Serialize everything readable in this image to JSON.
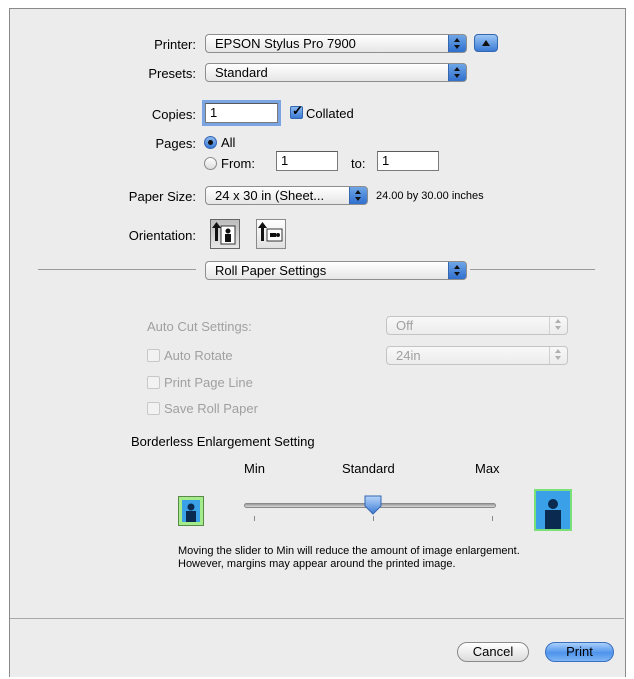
{
  "printer": {
    "label": "Printer:",
    "value": "EPSON Stylus Pro 7900"
  },
  "presets": {
    "label": "Presets:",
    "value": "Standard"
  },
  "copies": {
    "label": "Copies:",
    "value": "1",
    "collated_label": "Collated",
    "collated": true
  },
  "pages": {
    "label": "Pages:",
    "all_label": "All",
    "from_label": "From:",
    "from_value": "1",
    "to_label": "to:",
    "to_value": "1"
  },
  "paper_size": {
    "label": "Paper Size:",
    "value": "24 x 30 in (Sheet...",
    "dimensions": "24.00 by 30.00 inches"
  },
  "orientation": {
    "label": "Orientation:"
  },
  "panel_popup": {
    "value": "Roll Paper Settings"
  },
  "roll": {
    "auto_cut_label": "Auto Cut Settings:",
    "auto_cut_value": "Off",
    "auto_rotate_label": "Auto Rotate",
    "auto_rotate_value": "24in",
    "print_page_line_label": "Print Page Line",
    "save_roll_paper_label": "Save Roll Paper"
  },
  "borderless": {
    "title": "Borderless Enlargement Setting",
    "min_label": "Min",
    "standard_label": "Standard",
    "max_label": "Max",
    "slider_level": 0.5,
    "note_line1": "Moving the slider to Min will reduce the amount of image enlargement.",
    "note_line2": "However, margins may appear around the printed image."
  },
  "buttons": {
    "cancel": "Cancel",
    "print": "Print"
  },
  "colors": {
    "accent": "#4f93ec",
    "window_bg": "#ececec"
  }
}
